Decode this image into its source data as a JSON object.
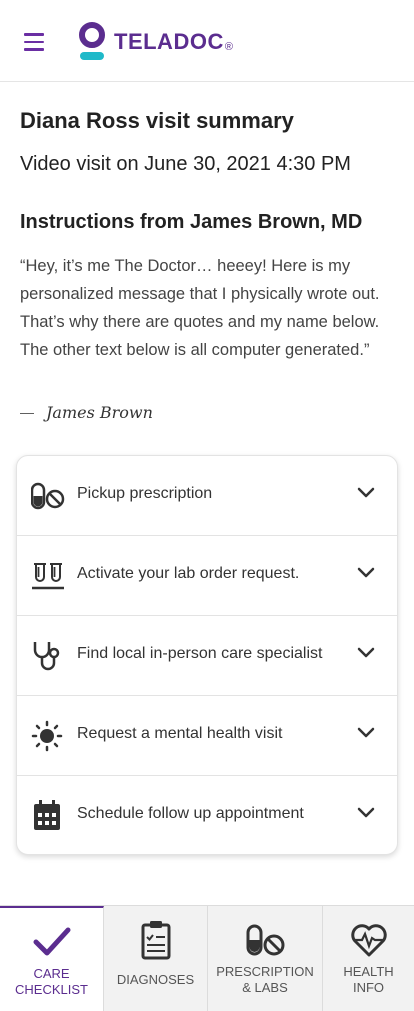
{
  "brand": {
    "name": "TELADOC",
    "mark": "®",
    "color": "#5b2d8f",
    "accent_teal": "#1fb9c9"
  },
  "header": {
    "menu_icon": "hamburger-icon"
  },
  "summary": {
    "title": "Diana Ross visit summary",
    "visit_line": "Video visit on June 30, 2021  4:30 PM"
  },
  "instructions": {
    "title": "Instructions from James Brown, MD",
    "message": "“Hey, it’s me The Doctor… heeey!  Here is my personalized message that I physically wrote out. That’s why there are quotes and my name below.  The other text below is all computer generated.”",
    "signature_dash": "—",
    "signature": "James Brown"
  },
  "checklist": [
    {
      "label": "Pickup prescription",
      "icon": "pill-icon"
    },
    {
      "label": "Activate your lab order request.",
      "icon": "test-tubes-icon"
    },
    {
      "label": "Find local in-person care specialist",
      "icon": "stethoscope-icon"
    },
    {
      "label": "Request a mental health visit",
      "icon": "sun-icon"
    },
    {
      "label": "Schedule follow up appointment",
      "icon": "calendar-icon"
    }
  ],
  "tabs": [
    {
      "line1": "CARE",
      "line2": "CHECKLIST",
      "icon": "checkmark-icon",
      "active": true
    },
    {
      "line1": "DIAGNOSES",
      "line2": "",
      "icon": "clipboard-icon",
      "active": false
    },
    {
      "line1": "PRESCRIPTION",
      "line2": "& LABS",
      "icon": "pill-icon",
      "active": false
    },
    {
      "line1": "HEALTH",
      "line2": "INFO",
      "icon": "heart-pulse-icon",
      "active": false
    }
  ]
}
